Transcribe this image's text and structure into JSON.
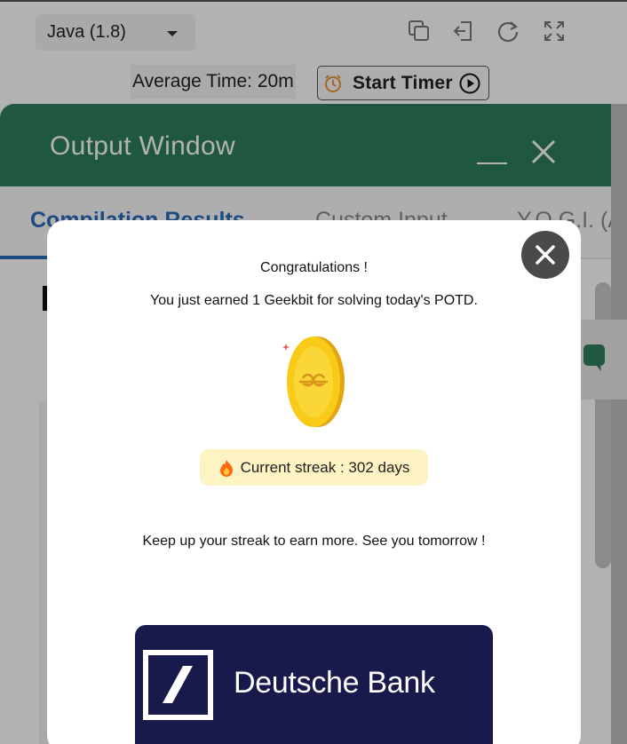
{
  "editor": {
    "language_selected": "Java (1.8)",
    "average_time": "Average Time: 20m",
    "start_timer_label": "Start Timer"
  },
  "output_window": {
    "title": "Output Window",
    "tabs": [
      {
        "label": "Compilation Results",
        "active": true
      },
      {
        "label": "Custom Input",
        "active": false
      },
      {
        "label": "Y.O.G.I. (AI Bot)",
        "active": false
      }
    ]
  },
  "modal": {
    "title": "Congratulations !",
    "subtitle": "You just earned 1 Geekbit for solving today's POTD.",
    "coin_icon": "geekbit-coin-icon",
    "streak_text": "Current streak : 302 days",
    "message": "Keep up your streak to earn more. See you tomorrow !",
    "banner": {
      "brand_name": "Deutsche Bank",
      "background_color": "#181a4c"
    }
  },
  "colors": {
    "header_green": "#2e7d5b",
    "tab_active_blue": "#2a6ab8",
    "streak_badge_bg": "#fdf3c3",
    "coin_gold": "#f5c518"
  }
}
